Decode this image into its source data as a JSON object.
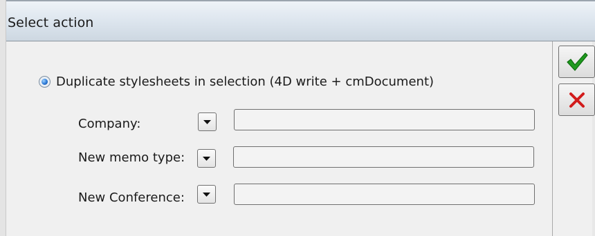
{
  "window": {
    "title": "Select action"
  },
  "option": {
    "label": "Duplicate stylesheets in selection (4D write + cmDocument)",
    "selected": true
  },
  "fields": [
    {
      "label": "Company:",
      "value": ""
    },
    {
      "label": "New memo type:",
      "value": ""
    },
    {
      "label": "New Conference:",
      "value": ""
    }
  ],
  "buttons": {
    "ok_icon": "checkmark-icon",
    "cancel_icon": "cross-icon",
    "ok_color": "#1f9a1f",
    "cancel_color": "#d21c1c"
  }
}
